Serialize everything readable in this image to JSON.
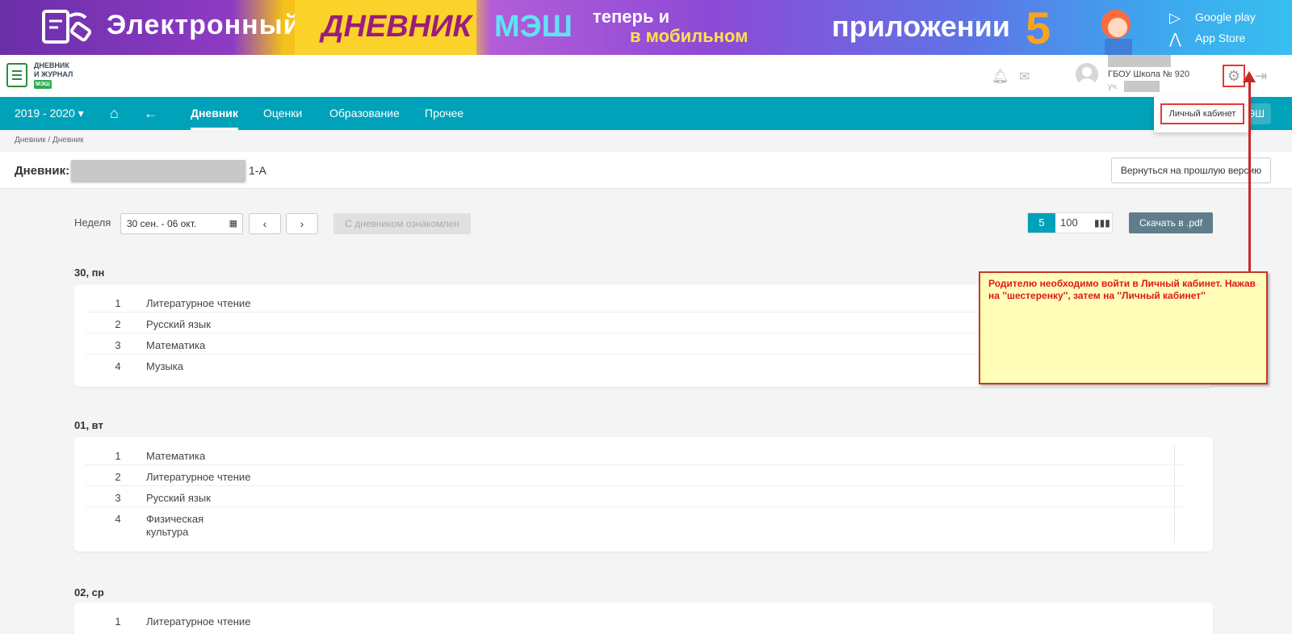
{
  "banner": {
    "text_electronic": "Электронный",
    "text_diary": "ДНЕВНИК",
    "text_mesh": "МЭШ",
    "text_now": "теперь и",
    "text_mobile": "в мобильном",
    "text_app": "приложении",
    "google_play": "Google play",
    "app_store": "App Store"
  },
  "logo": {
    "line1": "ДНЕВНИК",
    "line2": "И ЖУРНАЛ",
    "badge": "МЭШ"
  },
  "user": {
    "school": "ГБОУ Школа № 920",
    "sub": "уч."
  },
  "nav": {
    "year": "2019 - 2020",
    "items": [
      "Дневник",
      "Оценки",
      "Образование",
      "Прочее"
    ],
    "mesh_button": "ЭШ"
  },
  "dropdown": {
    "personal_cabinet": "Личный кабинет"
  },
  "breadcrumb": "Дневник / Дневник",
  "title": {
    "label": "Дневник:",
    "class": "1-А",
    "back_button": "Вернуться на прошлую версию"
  },
  "toolbar": {
    "week_label": "Неделя",
    "week_value": "30 сен. - 06 окт.",
    "ack_button": "С дневником ознакомлен",
    "scale_5": "5",
    "scale_100": "100",
    "pdf_button": "Скачать в .pdf"
  },
  "days": [
    {
      "label": "30, пн",
      "lessons": [
        {
          "n": "1",
          "subject": "Литературное чтение"
        },
        {
          "n": "2",
          "subject": "Русский язык"
        },
        {
          "n": "3",
          "subject": "Математика"
        },
        {
          "n": "4",
          "subject": "Музыка"
        }
      ]
    },
    {
      "label": "01, вт",
      "lessons": [
        {
          "n": "1",
          "subject": "Математика"
        },
        {
          "n": "2",
          "subject": "Литературное чтение"
        },
        {
          "n": "3",
          "subject": "Русский язык"
        },
        {
          "n": "4",
          "subject": "Физическая\nкультура"
        }
      ]
    },
    {
      "label": "02, ср",
      "lessons": [
        {
          "n": "1",
          "subject": "Литературное чтение"
        }
      ]
    }
  ],
  "note": "Родителю необходимо войти в Личный кабинет. Нажав на ''шестеренку'', затем на ''Личный кабинет''",
  "colors": {
    "accent": "#00a2b9",
    "annotation": "#e53935",
    "note_bg": "#fffdb8"
  }
}
